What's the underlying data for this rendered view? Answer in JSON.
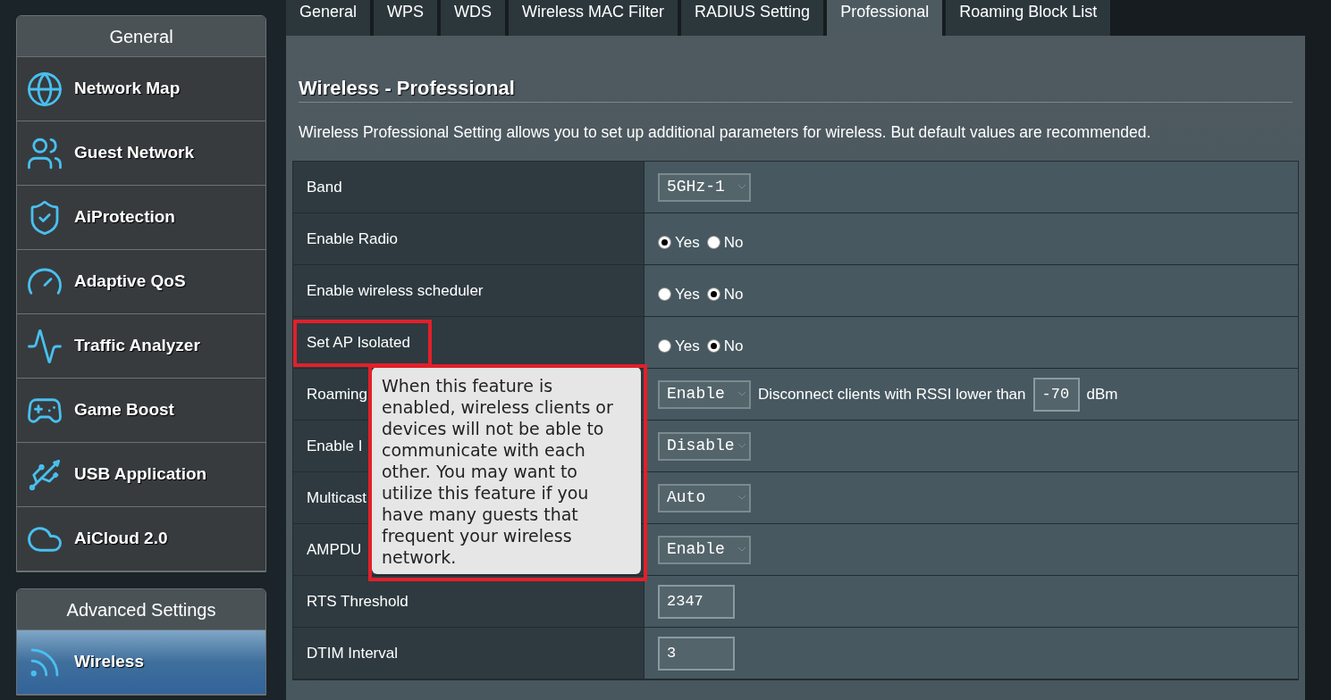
{
  "sidebar": {
    "sections": [
      {
        "title": "General",
        "items": [
          {
            "label": "Network Map",
            "kind": "map",
            "selected": false
          },
          {
            "label": "Guest Network",
            "kind": "guest",
            "selected": false
          },
          {
            "label": "AiProtection",
            "kind": "shield",
            "selected": false
          },
          {
            "label": "Adaptive QoS",
            "kind": "gauge",
            "selected": false
          },
          {
            "label": "Traffic Analyzer",
            "kind": "activity",
            "selected": false
          },
          {
            "label": "Game Boost",
            "kind": "game",
            "selected": false
          },
          {
            "label": "USB Application",
            "kind": "usb",
            "selected": false
          },
          {
            "label": "AiCloud 2.0",
            "kind": "cloud",
            "selected": false
          }
        ]
      },
      {
        "title": "Advanced Settings",
        "items": [
          {
            "label": "Wireless",
            "kind": "wifi",
            "selected": true
          }
        ]
      }
    ]
  },
  "tabs": [
    {
      "label": "General",
      "selected": false
    },
    {
      "label": "WPS",
      "selected": false
    },
    {
      "label": "WDS",
      "selected": false
    },
    {
      "label": "Wireless MAC Filter",
      "selected": false
    },
    {
      "label": "RADIUS Setting",
      "selected": false
    },
    {
      "label": "Professional",
      "selected": true
    },
    {
      "label": "Roaming Block List",
      "selected": false
    }
  ],
  "page": {
    "title": "Wireless - Professional",
    "description": "Wireless Professional Setting allows you to set up additional parameters for wireless. But default values are recommended."
  },
  "settings": [
    {
      "label": "Band",
      "kind": "select",
      "value": "5GHz-1"
    },
    {
      "label": "Enable Radio",
      "kind": "radio",
      "options": [
        {
          "label": "Yes",
          "selected": true
        },
        {
          "label": "No",
          "selected": false
        }
      ]
    },
    {
      "label": "Enable wireless scheduler",
      "kind": "radio",
      "options": [
        {
          "label": "Yes",
          "selected": false
        },
        {
          "label": "No",
          "selected": true
        }
      ]
    },
    {
      "label": "Set AP Isolated",
      "kind": "radio",
      "highlighted": true,
      "options": [
        {
          "label": "Yes",
          "selected": false
        },
        {
          "label": "No",
          "selected": true
        }
      ]
    },
    {
      "label": "Roaming",
      "kind": "roaming",
      "value": "Enable",
      "text": "Disconnect clients with RSSI lower than",
      "input": "-70",
      "unit": "dBm"
    },
    {
      "label": "Enable I",
      "kind": "select",
      "value": "Disable"
    },
    {
      "label": "Multicast",
      "kind": "select",
      "value": "Auto"
    },
    {
      "label": "AMPDU",
      "kind": "select",
      "value": "Enable"
    },
    {
      "label": "RTS Threshold",
      "kind": "input",
      "value": "2347"
    },
    {
      "label": "DTIM Interval",
      "kind": "input",
      "value": "3"
    }
  ],
  "tooltip": {
    "text": "When this feature is enabled, wireless clients or devices will not be able to communicate with each other. You may want to utilize this feature if you have many guests that frequent your wireless network.",
    "highlighted": true
  }
}
